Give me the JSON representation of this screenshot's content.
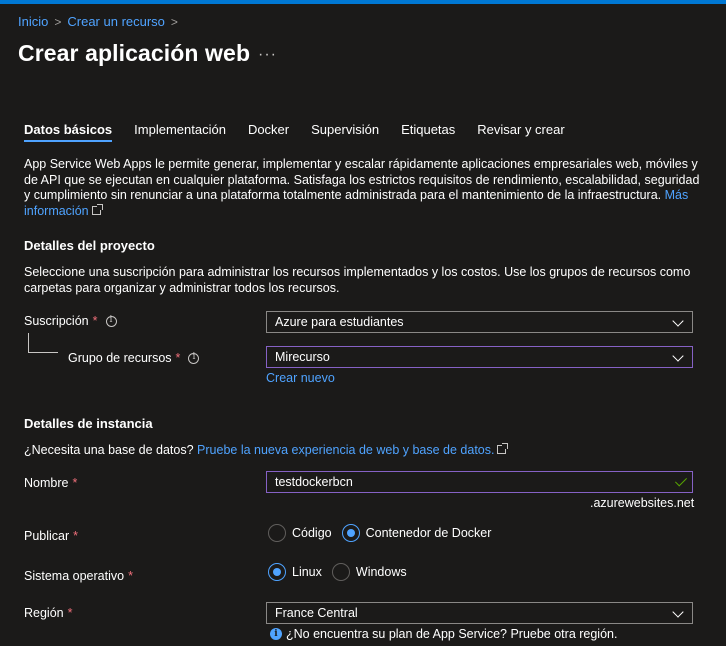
{
  "breadcrumb": {
    "home": "Inicio",
    "create_resource": "Crear un recurso"
  },
  "page": {
    "title": "Crear aplicación web",
    "more": "···"
  },
  "tabs": [
    {
      "label": "Datos básicos",
      "active": true
    },
    {
      "label": "Implementación"
    },
    {
      "label": "Docker"
    },
    {
      "label": "Supervisión"
    },
    {
      "label": "Etiquetas"
    },
    {
      "label": "Revisar y crear"
    }
  ],
  "intro": {
    "text": "App Service Web Apps le permite generar, implementar y escalar rápidamente aplicaciones empresariales web, móviles y de API que se ejecutan en cualquier plataforma. Satisfaga los estrictos requisitos de rendimiento, escalabilidad, seguridad y cumplimiento sin renunciar a una plataforma totalmente administrada para el mantenimiento de la infraestructura.",
    "link": "Más información"
  },
  "project": {
    "title": "Detalles del proyecto",
    "description": "Seleccione una suscripción para administrar los recursos implementados y los costos. Use los grupos de recursos como carpetas para organizar y administrar todos los recursos.",
    "subscription_label": "Suscripción",
    "subscription_value": "Azure para estudiantes",
    "resource_group_label": "Grupo de recursos",
    "resource_group_value": "Mirecurso",
    "create_new": "Crear nuevo"
  },
  "instance": {
    "title": "Detalles de instancia",
    "db_question": "¿Necesita una base de datos?",
    "db_link": "Pruebe la nueva experiencia de web y base de datos.",
    "name_label": "Nombre",
    "name_value": "testdockerbcn",
    "name_suffix": ".azurewebsites.net",
    "publish_label": "Publicar",
    "publish_options": [
      "Código",
      "Contenedor de Docker"
    ],
    "publish_selected": "Contenedor de Docker",
    "os_label": "Sistema operativo",
    "os_options": [
      "Linux",
      "Windows"
    ],
    "os_selected": "Linux",
    "region_label": "Región",
    "region_value": "France Central",
    "region_hint": "¿No encuentra su plan de App Service? Pruebe otra región."
  },
  "required_mark": "*",
  "colors": {
    "accent": "#4fa3ff",
    "required": "#f1707b",
    "focus_border": "#8661c5",
    "valid": "#57a300"
  }
}
